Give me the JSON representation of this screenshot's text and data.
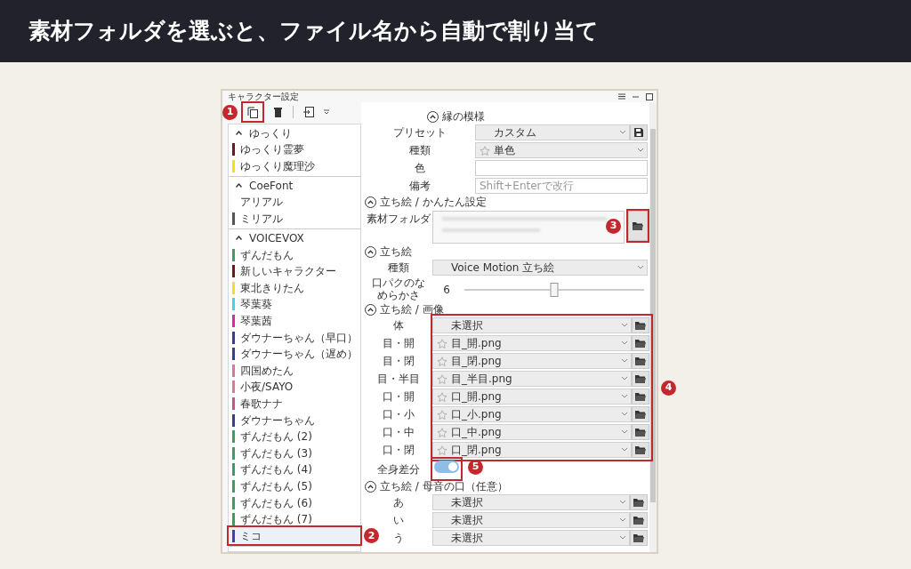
{
  "heading": "素材フォルダを選ぶと、ファイル名から自動で割り当て",
  "window": {
    "title": "キャラクター設定"
  },
  "toolbar": {
    "callout": "1"
  },
  "groups": [
    {
      "name": "ゆっくり",
      "expanded": true,
      "items": [
        {
          "name": "ゆっくり霊夢",
          "color": "#7a1020",
          "selected": false
        },
        {
          "name": "ゆっくり魔理沙",
          "color": "#f2e400",
          "selected": false
        }
      ]
    },
    {
      "name": "CoeFont",
      "expanded": true,
      "items": [
        {
          "name": "アリアル",
          "selected": false
        },
        {
          "name": "ミリアル",
          "color": "#555555",
          "selected": false
        }
      ]
    },
    {
      "name": "VOICEVOX",
      "expanded": true,
      "items": [
        {
          "name": "ずんだもん",
          "color": "#3aa060",
          "selected": false
        },
        {
          "name": "新しいキャラクター",
          "color": "#7a1020",
          "selected": false
        },
        {
          "name": "東北きりたん",
          "color": "#f0e020",
          "selected": false
        },
        {
          "name": "琴葉葵",
          "color": "#40d8e0",
          "selected": false
        },
        {
          "name": "琴葉茜",
          "color": "#e0289a",
          "selected": false
        },
        {
          "name": "ダウナーちゃん（早口）",
          "color": "#3a3a9a",
          "selected": false
        },
        {
          "name": "ダウナーちゃん（遅め）",
          "color": "#3a3a9a",
          "selected": false
        },
        {
          "name": "四国めたん",
          "color": "#e070a0",
          "selected": false
        },
        {
          "name": "小夜/SAYO",
          "color": "#e07890",
          "selected": false
        },
        {
          "name": "春歌ナナ",
          "color": "#d0508a",
          "selected": false
        },
        {
          "name": "ダウナーちゃん",
          "color": "#3a3a9a",
          "selected": false
        },
        {
          "name": "ずんだもん (2)",
          "color": "#3aa060",
          "selected": false
        },
        {
          "name": "ずんだもん (3)",
          "color": "#3aa060",
          "selected": false
        },
        {
          "name": "ずんだもん (4)",
          "color": "#3aa060",
          "selected": false
        },
        {
          "name": "ずんだもん (5)",
          "color": "#3aa060",
          "selected": false
        },
        {
          "name": "ずんだもん (6)",
          "color": "#3aa060",
          "selected": false
        },
        {
          "name": "ずんだもん (7)",
          "color": "#3aa060",
          "selected": false
        },
        {
          "name": "ミコ",
          "color": "#4a3ab0",
          "selected": true,
          "callout": "2"
        }
      ]
    }
  ],
  "sections": [
    {
      "title": "縁の模様",
      "expanded": true,
      "rows": [
        {
          "kind": "preset",
          "label": "プリセット",
          "value": "カスタム",
          "star": false
        },
        {
          "kind": "select",
          "label": "種類",
          "value": "単色",
          "star": true
        },
        {
          "kind": "text",
          "label": "色"
        },
        {
          "kind": "text",
          "label": "備考",
          "placeholder": "Shift+Enterで改行"
        }
      ]
    },
    {
      "title": "立ち絵 / かんたん設定",
      "expanded": true,
      "rows": [
        {
          "kind": "folder",
          "label": "素材フォルダ",
          "callout": "3"
        }
      ]
    },
    {
      "title": "立ち絵",
      "expanded": true,
      "rows": [
        {
          "kind": "select",
          "label": "種類",
          "value": "Voice Motion 立ち絵",
          "star": false
        },
        {
          "kind": "slider",
          "label": "口パクのなめらかさ",
          "value": "6",
          "level": 0.5
        }
      ]
    },
    {
      "title": "立ち絵 / 画像",
      "expanded": true,
      "rows": [
        {
          "kind": "files",
          "callout": "4",
          "items": [
            {
              "label": "体",
              "value": "未選択",
              "star": false
            },
            {
              "label": "目・開",
              "value": "目_開.png",
              "star": true
            },
            {
              "label": "目・閉",
              "value": "目_閉.png",
              "star": true
            },
            {
              "label": "目・半目",
              "value": "目_半目.png",
              "star": true
            },
            {
              "label": "口・開",
              "value": "口_開.png",
              "star": true
            },
            {
              "label": "口・小",
              "value": "口_小.png",
              "star": true
            },
            {
              "label": "口・中",
              "value": "口_中.png",
              "star": true
            },
            {
              "label": "口・閉",
              "value": "口_閉.png",
              "star": true
            }
          ]
        },
        {
          "kind": "toggle",
          "label": "全身差分",
          "on": true,
          "callout": "5"
        }
      ]
    },
    {
      "title": "立ち絵 / 母音の口（任意）",
      "expanded": true,
      "rows": [
        {
          "kind": "files",
          "items": [
            {
              "label": "あ",
              "value": "未選択",
              "star": false
            },
            {
              "label": "い",
              "value": "未選択",
              "star": false
            },
            {
              "label": "う",
              "value": "未選択",
              "star": false
            }
          ]
        }
      ]
    }
  ]
}
